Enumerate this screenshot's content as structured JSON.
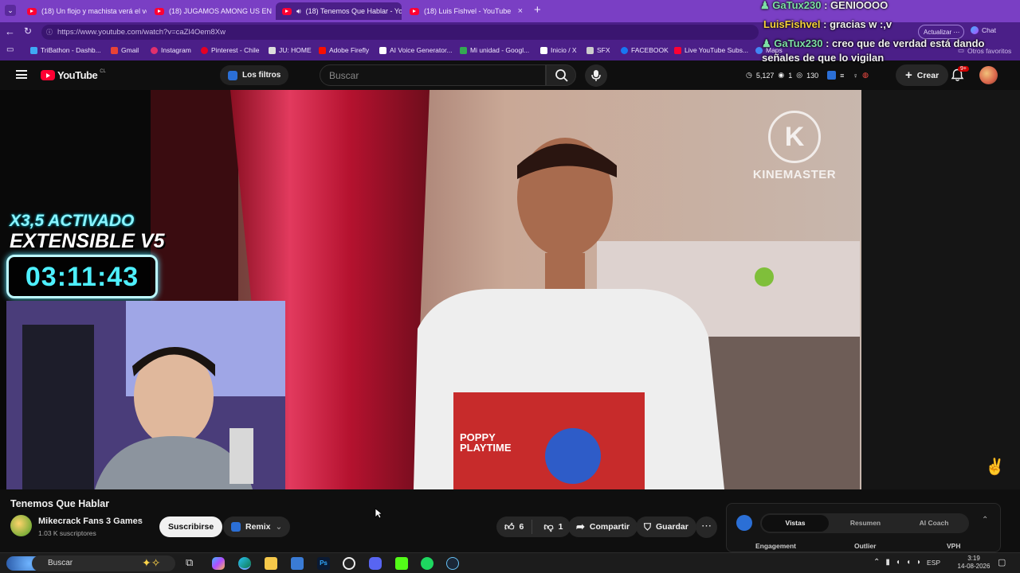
{
  "browser": {
    "tabs": [
      {
        "title": "(18) Un flojo y machista verá el ve",
        "active": false
      },
      {
        "title": "(18) JUGAMOS AMONG US EN LA",
        "active": false
      },
      {
        "title": "(18) Tenemos Que Hablar - Yo",
        "active": true
      },
      {
        "title": "(18) Luis Fishvel - YouTube",
        "active": false
      }
    ],
    "new_tab": "+",
    "url": "https://www.youtube.com/watch?v=caZl4Oem8Xw",
    "update_label": "Actualizar",
    "chat_label": "Chat",
    "other_favorites": "Otros favoritos",
    "bookmarks": [
      {
        "label": "TriBathon - Dashb...",
        "color": "#3fa9f5"
      },
      {
        "label": "Gmail",
        "color": "#ea4335"
      },
      {
        "label": "Instagram",
        "color": "#e1306c"
      },
      {
        "label": "Pinterest - Chile",
        "color": "#e60023"
      },
      {
        "label": "JU: HOME",
        "color": "#dddddd"
      },
      {
        "label": "Adobe Firefly",
        "color": "#fa0f00"
      },
      {
        "label": "AI Voice Generator...",
        "color": "#ffffff"
      },
      {
        "label": "Mi unidad - Googl...",
        "color": "#34a853"
      },
      {
        "label": "Inicio / X",
        "color": "#ffffff"
      },
      {
        "label": "SFX",
        "color": "#cccccc"
      },
      {
        "label": "FACEBOOK",
        "color": "#1877f2"
      },
      {
        "label": "Live YouTube Subs...",
        "color": "#ff0033"
      },
      {
        "label": "Maps",
        "color": "#4285f4"
      }
    ]
  },
  "youtube": {
    "logo_text": "YouTube",
    "country": "CL",
    "filters_label": "Los filtros",
    "search_placeholder": "Buscar",
    "stats": {
      "time": "5,127",
      "count": "1",
      "views": "130"
    },
    "create_label": "Crear",
    "notif_badge": "9+"
  },
  "chat": [
    {
      "user": "GaTux230",
      "msg": "GENIOOOO",
      "color": "#7ee0a6"
    },
    {
      "user": "LuisFishvel",
      "msg": "gracias w :,v",
      "color": "#f5d23a"
    },
    {
      "user": "GaTux230",
      "msg": "creo que de verdad está dando señales de que lo vigilan",
      "color": "#7ee0a6"
    }
  ],
  "overlay": {
    "line1": "X3,5 ACTIVADO",
    "line2": "EXTENSIBLE V5",
    "timer": "03:11:43"
  },
  "video": {
    "watermark": "KINEMASTER",
    "shirt_text": "POPPY PLAYTIME"
  },
  "meta": {
    "title": "Tenemos Que Hablar",
    "channel": "Mikecrack Fans 3 Games",
    "subscribers": "1.03 K suscriptores",
    "subscribe_label": "Suscribirse",
    "remix_label": "Remix",
    "likes": "6",
    "dislikes": "1",
    "share_label": "Compartir",
    "save_label": "Guardar"
  },
  "panel": {
    "tabs": [
      "Vistas",
      "Resumen",
      "AI Coach"
    ],
    "active_tab": "Vistas",
    "columns": [
      "Engagement",
      "Outlier",
      "VPH"
    ]
  },
  "taskbar": {
    "search_label": "Buscar",
    "lang": "ESP",
    "time": "3:19",
    "date": "14-08-2026"
  }
}
